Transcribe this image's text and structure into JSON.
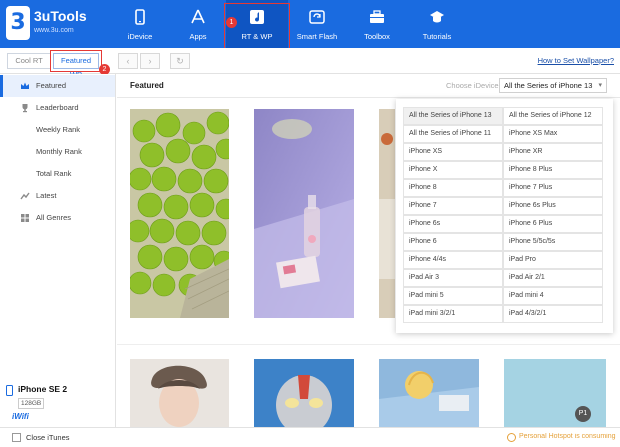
{
  "app": {
    "brand": "3uTools",
    "site": "www.3u.com",
    "logo_glyph": "3"
  },
  "nav": [
    {
      "label": "iDevice",
      "icon": "phone-icon"
    },
    {
      "label": "Apps",
      "icon": "appstore-icon"
    },
    {
      "label": "RT & WP",
      "icon": "music-icon"
    },
    {
      "label": "Smart Flash",
      "icon": "flash-icon"
    },
    {
      "label": "Toolbox",
      "icon": "toolbox-icon"
    },
    {
      "label": "Tutorials",
      "icon": "graduation-cap-icon"
    }
  ],
  "annotations": {
    "one": "1",
    "two": "2"
  },
  "toolbar": {
    "tab1": "Cool RT",
    "tab2": "Featured WP",
    "back": "‹",
    "forward": "›",
    "refresh": "↻",
    "wallpaper_link": "How to Set Wallpaper?"
  },
  "sidebar": {
    "items": [
      {
        "label": "Featured",
        "icon": "crown-icon"
      },
      {
        "label": "Leaderboard",
        "icon": "trophy-icon"
      },
      {
        "label": "Weekly Rank"
      },
      {
        "label": "Monthly Rank"
      },
      {
        "label": "Total Rank"
      },
      {
        "label": "Latest",
        "icon": "latest-icon"
      },
      {
        "label": "All Genres",
        "icon": "grid-icon"
      }
    ],
    "device": {
      "name": "iPhone SE 2",
      "capacity": "128GB"
    },
    "wifi_logo": "iWifi"
  },
  "main": {
    "title": "Featured",
    "choose_label": "Choose iDevice:",
    "selected_device": "All the Series of iPhone 13"
  },
  "dropdown": {
    "options": [
      [
        "All the Series of iPhone 13",
        "All the Series of iPhone 12"
      ],
      [
        "All the Series of iPhone 11",
        "iPhone XS Max"
      ],
      [
        "iPhone XS",
        "iPhone XR"
      ],
      [
        "iPhone X",
        "iPhone 8 Plus"
      ],
      [
        "iPhone 8",
        "iPhone 7 Plus"
      ],
      [
        "iPhone 7",
        "iPhone 6s Plus"
      ],
      [
        "iPhone 6s",
        "iPhone 6 Plus"
      ],
      [
        "iPhone 6",
        "iPhone 5/5c/5s"
      ],
      [
        "iPhone 4/4s",
        "iPad Pro"
      ],
      [
        "iPad Air 3",
        "iPad Air 2/1"
      ],
      [
        "iPad mini 5",
        "iPad mini 4"
      ],
      [
        "iPad mini 3/2/1",
        "iPad 4/3/2/1"
      ]
    ]
  },
  "footer": {
    "close_itunes": "Close iTunes",
    "hotspot": "Personal Hotspot is consuming",
    "page_badge": "P1"
  },
  "colors": {
    "accent": "#1a6be0",
    "highlight": "#e53935"
  }
}
